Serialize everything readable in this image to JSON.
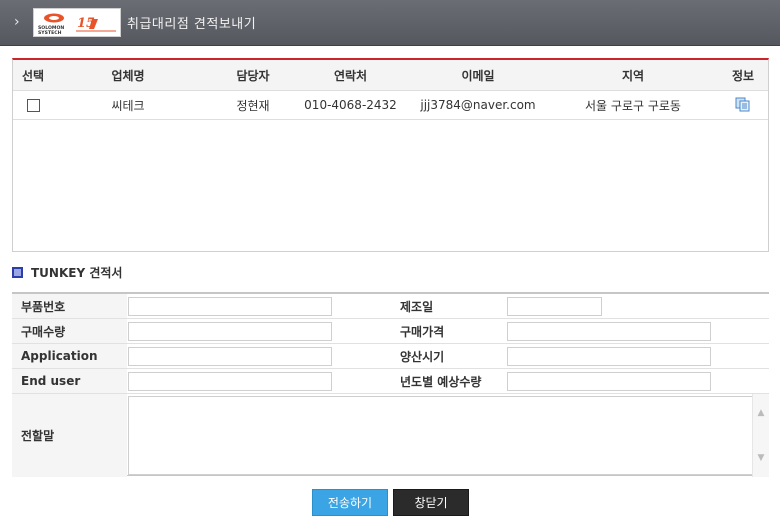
{
  "header": {
    "title": "취급대리점 견적보내기",
    "logo_text": "SOLOMON SYSTECH",
    "logo_anniv": "15th"
  },
  "vendor_table": {
    "columns": [
      "선택",
      "업체명",
      "담당자",
      "연락처",
      "이메일",
      "지역",
      "정보"
    ],
    "rows": [
      {
        "checked": false,
        "company": "씨테크",
        "manager": "정현재",
        "phone": "010-4068-2432",
        "email": "jjj3784@naver.com",
        "region": "서울 구로구 구로동",
        "info_icon": "document-copy-icon"
      }
    ]
  },
  "section": {
    "title": "TUNKEY 견적서"
  },
  "form": {
    "part_no_label": "부품번호",
    "part_no_value": "",
    "manufacturer_label": "제조일",
    "manufacturer_value": "",
    "qty_label": "구매수량",
    "qty_value": "",
    "price_label": "구매가격",
    "price_value": "",
    "application_label": "Application",
    "application_value": "",
    "mass_prod_label": "양산시기",
    "mass_prod_value": "",
    "end_user_label": "End user",
    "end_user_value": "",
    "yearly_qty_label": "년도별 예상수량",
    "yearly_qty_value": "",
    "message_label": "전할말",
    "message_value": ""
  },
  "buttons": {
    "send": "전송하기",
    "close": "창닫기"
  },
  "colors": {
    "header_bg": "#5f6269",
    "table_top_border": "#c8262b",
    "send_button": "#3aa4e4",
    "close_button": "#2b2b2b",
    "section_icon": "#2c3ea8"
  }
}
